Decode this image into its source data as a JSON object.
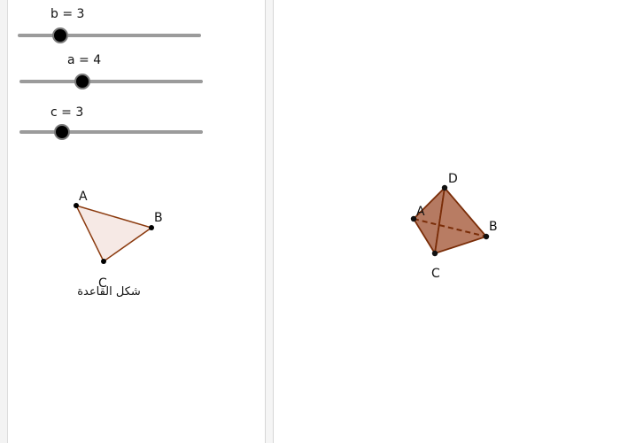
{
  "sliders": [
    {
      "label": "b = 3",
      "value": 3
    },
    {
      "label": "a = 4",
      "value": 4
    },
    {
      "label": "c = 3",
      "value": 3
    }
  ],
  "base_triangle": {
    "points": {
      "a": "A",
      "b": "B",
      "c": "C"
    },
    "caption": "شكل القاعدة",
    "fill": "#f6e9e5",
    "stroke": "#8b3a0e"
  },
  "tetrahedron": {
    "points": {
      "a": "A",
      "b": "B",
      "c": "C",
      "d": "D"
    },
    "face_color": "#b06f55",
    "edge_color": "#7a2d08"
  }
}
